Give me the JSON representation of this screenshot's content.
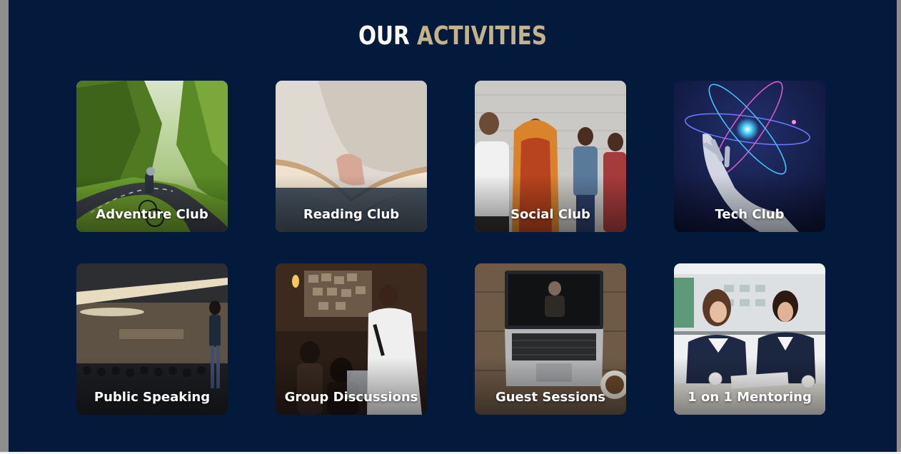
{
  "section": {
    "title_part1": "OUR",
    "title_part2": "ACTIVITIES",
    "title_accent_color": "#c4b28a",
    "background_color": "#041a3c"
  },
  "activities": [
    {
      "label": "Adventure Club",
      "image": "cyclist-on-mountain-road"
    },
    {
      "label": "Reading Club",
      "image": "open-book-in-hands"
    },
    {
      "label": "Social Club",
      "image": "women-and-children-by-wall"
    },
    {
      "label": "Tech Club",
      "image": "robot-hand-with-atom"
    },
    {
      "label": "Public Speaking",
      "image": "speaker-in-conference-hall"
    },
    {
      "label": "Group Discussions",
      "image": "woman-speaking-with-microphone"
    },
    {
      "label": "Guest Sessions",
      "image": "laptop-video-call"
    },
    {
      "label": "1 on 1 Mentoring",
      "image": "two-women-reviewing-papers"
    }
  ]
}
